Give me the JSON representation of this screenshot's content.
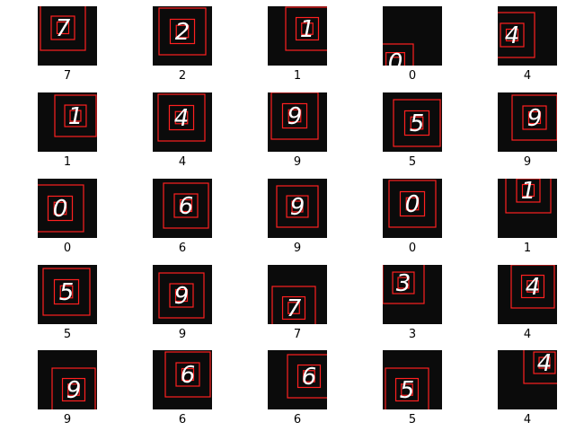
{
  "grid": {
    "rows": 5,
    "cols": 5,
    "box_color": "#ff2020",
    "digit_color": "#ffffff",
    "background_color": "#0b0b0b",
    "labels": [
      "7",
      "2",
      "1",
      "0",
      "4",
      "1",
      "4",
      "9",
      "5",
      "9",
      "0",
      "6",
      "9",
      "0",
      "1",
      "5",
      "9",
      "7",
      "3",
      "4",
      "9",
      "6",
      "6",
      "5",
      "4"
    ]
  }
}
